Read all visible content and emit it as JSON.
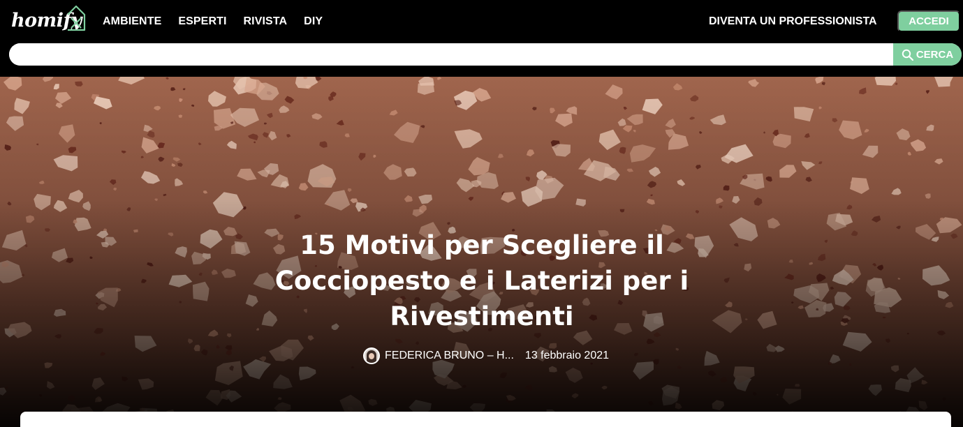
{
  "brand": {
    "logo_text": "homify",
    "accent": "#7fcf9f"
  },
  "nav": {
    "items": [
      "AMBIENTE",
      "ESPERTI",
      "RIVISTA",
      "DIY"
    ]
  },
  "header": {
    "pro_link": "DIVENTA UN PROFESSIONISTA",
    "login_button": "ACCEDI"
  },
  "search": {
    "placeholder": "",
    "value": "",
    "button_label": "CERCA",
    "button_icon": "search-icon"
  },
  "article": {
    "title": "15 Motivi per Scegliere il Cocciopesto e i Laterizi per i Rivestimenti",
    "author": "FEDERICA BRUNO – H...",
    "date": "13 febbraio 2021"
  }
}
